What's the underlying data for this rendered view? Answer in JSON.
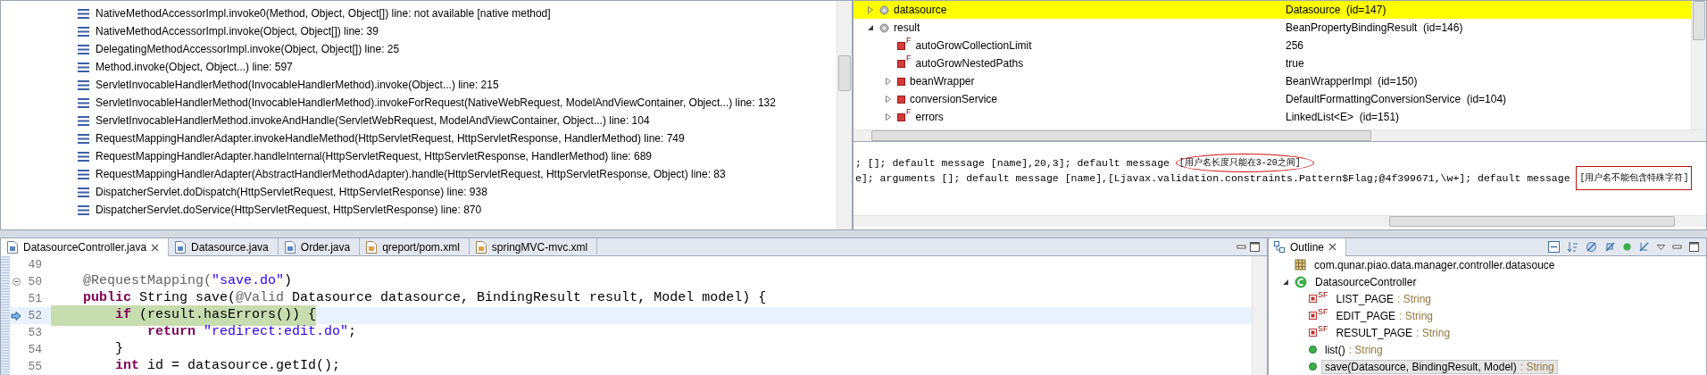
{
  "stack_frames": [
    "NativeMethodAccessorImpl.invoke0(Method, Object, Object[]) line: not available [native method]",
    "NativeMethodAccessorImpl.invoke(Object, Object[]) line: 39",
    "DelegatingMethodAccessorImpl.invoke(Object, Object[]) line: 25",
    "Method.invoke(Object, Object...) line: 597",
    "ServletInvocableHandlerMethod(InvocableHandlerMethod).invoke(Object...) line: 215",
    "ServletInvocableHandlerMethod(InvocableHandlerMethod).invokeForRequest(NativeWebRequest, ModelAndViewContainer, Object...) line: 132",
    "ServletInvocableHandlerMethod.invokeAndHandle(ServletWebRequest, ModelAndViewContainer, Object...) line: 104",
    "RequestMappingHandlerAdapter.invokeHandleMethod(HttpServletRequest, HttpServletResponse, HandlerMethod) line: 749",
    "RequestMappingHandlerAdapter.handleInternal(HttpServletRequest, HttpServletResponse, HandlerMethod) line: 689",
    "RequestMappingHandlerAdapter(AbstractHandlerMethodAdapter).handle(HttpServletRequest, HttpServletResponse, Object) line: 83",
    "DispatcherServlet.doDispatch(HttpServletRequest, HttpServletResponse) line: 938",
    "DispatcherServlet.doService(HttpServletRequest, HttpServletResponse) line: 870"
  ],
  "variables": [
    {
      "name": "datasource",
      "value": "Datasource  (id=147)",
      "kind": "local",
      "selected": true,
      "expanded": false
    },
    {
      "name": "result",
      "value": "BeanPropertyBindingResult  (id=146)",
      "kind": "local",
      "selected": false,
      "expanded": true,
      "children": [
        {
          "name": "autoGrowCollectionLimit",
          "value": "256",
          "kind": "field",
          "modifier": "F",
          "selected": false
        },
        {
          "name": "autoGrowNestedPaths",
          "value": "true",
          "kind": "field",
          "modifier": "F",
          "selected": false
        },
        {
          "name": "beanWrapper",
          "value": "BeanWrapperImpl  (id=150)",
          "kind": "field",
          "selected": false,
          "expanded": false
        },
        {
          "name": "conversionService",
          "value": "DefaultFormattingConversionService  (id=104)",
          "kind": "field",
          "selected": false,
          "expanded": false
        },
        {
          "name": "errors",
          "value": "LinkedList<E>  (id=151)",
          "kind": "field",
          "modifier": "F",
          "selected": false,
          "expanded": false
        }
      ]
    }
  ],
  "console": [
    {
      "text": "; []; default message [name],20,3]; default message ",
      "message": "[用户名长度只能在3-20之间]",
      "kind": "ellipse"
    },
    {
      "text": "e]; arguments []; default message [name],[Ljavax.validation.constraints.Pattern$Flag;@4f399671,\\w+]; default message ",
      "message": "[用户名不能包含特殊字符]",
      "kind": "rectangle"
    }
  ],
  "editor": {
    "tabs": [
      {
        "label": "DatasourceController.java",
        "kind": "java",
        "selected": true
      },
      {
        "label": "Datasource.java",
        "kind": "java",
        "selected": false
      },
      {
        "label": "Order.java",
        "kind": "java",
        "selected": false
      },
      {
        "label": "qreport/pom.xml",
        "kind": "xml",
        "selected": false
      },
      {
        "label": "springMVC-mvc.xml",
        "kind": "xml",
        "selected": false
      }
    ],
    "lines": [
      {
        "number": "49",
        "kind": "plain",
        "current": false
      },
      {
        "number": "50",
        "kind": "fold",
        "current": false,
        "tokens": [
          {
            "kind": "annotation",
            "text": "    @RequestMapping("
          },
          {
            "kind": "string",
            "text": "\"save.do\""
          },
          {
            "kind": "plain",
            "text": ")"
          }
        ]
      },
      {
        "number": "51",
        "kind": "plain",
        "current": false,
        "tokens": [
          {
            "kind": "keyword",
            "text": "    public"
          },
          {
            "kind": "plain",
            "text": " String save("
          },
          {
            "kind": "annotation",
            "text": "@Valid"
          },
          {
            "kind": "plain",
            "text": " Datasource datasource, BindingResult result, Model model) {"
          }
        ]
      },
      {
        "number": "52",
        "kind": "pointer",
        "current": true,
        "tokens": [
          {
            "kind": "keyword",
            "text": "        if"
          },
          {
            "kind": "plain",
            "text": " (result.hasErrors()) {"
          }
        ]
      },
      {
        "number": "53",
        "kind": "plain",
        "current": false,
        "tokens": [
          {
            "kind": "keyword",
            "text": "            return"
          },
          {
            "kind": "string",
            "text": " \"redirect:edit.do\""
          },
          {
            "kind": "plain",
            "text": ";"
          }
        ]
      },
      {
        "number": "54",
        "kind": "plain",
        "current": false,
        "tokens": [
          {
            "kind": "plain",
            "text": "        }"
          }
        ]
      },
      {
        "number": "55",
        "kind": "plain",
        "current": false,
        "tokens": [
          {
            "kind": "keyword",
            "text": "        int"
          },
          {
            "kind": "plain",
            "text": " id = datasource.getId();"
          }
        ]
      }
    ]
  },
  "outline": {
    "title": "Outline",
    "items": [
      {
        "kind": "package",
        "label": "com.qunar.piao.data.manager.controller.datasouce",
        "selected": false
      },
      {
        "kind": "class",
        "label": "DatasourceController",
        "selected": false,
        "expanded": true,
        "children": [
          {
            "kind": "constant",
            "modifier": "SF",
            "label": "LIST_PAGE",
            "type": ": String",
            "selected": false
          },
          {
            "kind": "constant",
            "modifier": "SF",
            "label": "EDIT_PAGE",
            "type": ": String",
            "selected": false
          },
          {
            "kind": "constant",
            "modifier": "SF",
            "label": "RESULT_PAGE",
            "type": ": String",
            "selected": false
          },
          {
            "kind": "method",
            "label": "list()",
            "type": ": String",
            "selected": false
          },
          {
            "kind": "method",
            "label": "save(Datasource, BindingResult, Model)",
            "type": ": String",
            "selected": true
          }
        ]
      }
    ]
  }
}
